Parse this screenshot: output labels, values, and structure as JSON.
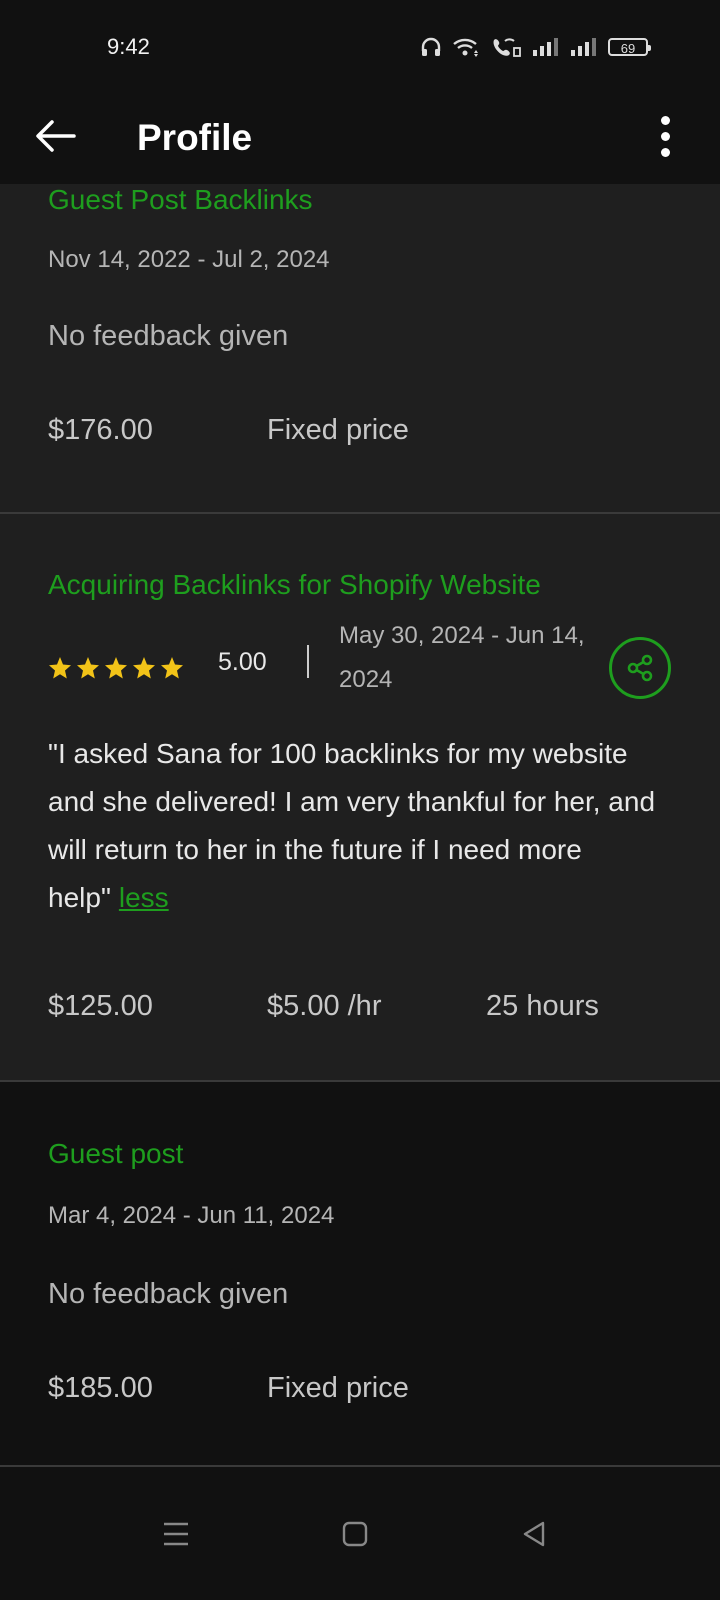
{
  "status_bar": {
    "time": "9:42",
    "battery": "69"
  },
  "app_bar": {
    "title": "Profile"
  },
  "jobs": [
    {
      "title": "Guest Post Backlinks",
      "date_range": "Nov 14, 2022 - Jul 2, 2024",
      "feedback": "No feedback given",
      "price": "$176.00",
      "price_type": "Fixed price"
    },
    {
      "title": "Acquiring Backlinks for Shopify Website",
      "rating": "5.00",
      "stars": 5,
      "date_range": "May 30, 2024 - Jun 14, 2024",
      "review": "\"I asked Sana for 100 backlinks for my website and she delivered! I am very thankful for her, and will return to her in the future if I need more help\"",
      "less_label": "less",
      "price": "$125.00",
      "rate": "$5.00 /hr",
      "hours": "25 hours"
    },
    {
      "title": "Guest post",
      "date_range": "Mar 4, 2024 - Jun 11, 2024",
      "feedback": "No feedback given",
      "price": "$185.00",
      "price_type": "Fixed price"
    }
  ],
  "colors": {
    "accent_green": "#1e9e1e",
    "star_yellow": "#f2c318",
    "background": "#111111",
    "card": "#1f1f1f"
  },
  "icons": [
    "headphones-icon",
    "wifi-icon",
    "wifi-call-icon",
    "signal-icon",
    "battery-icon",
    "back-arrow-icon",
    "more-vert-icon",
    "star-icon",
    "share-icon",
    "nav-menu-icon",
    "nav-home-icon",
    "nav-back-icon"
  ]
}
